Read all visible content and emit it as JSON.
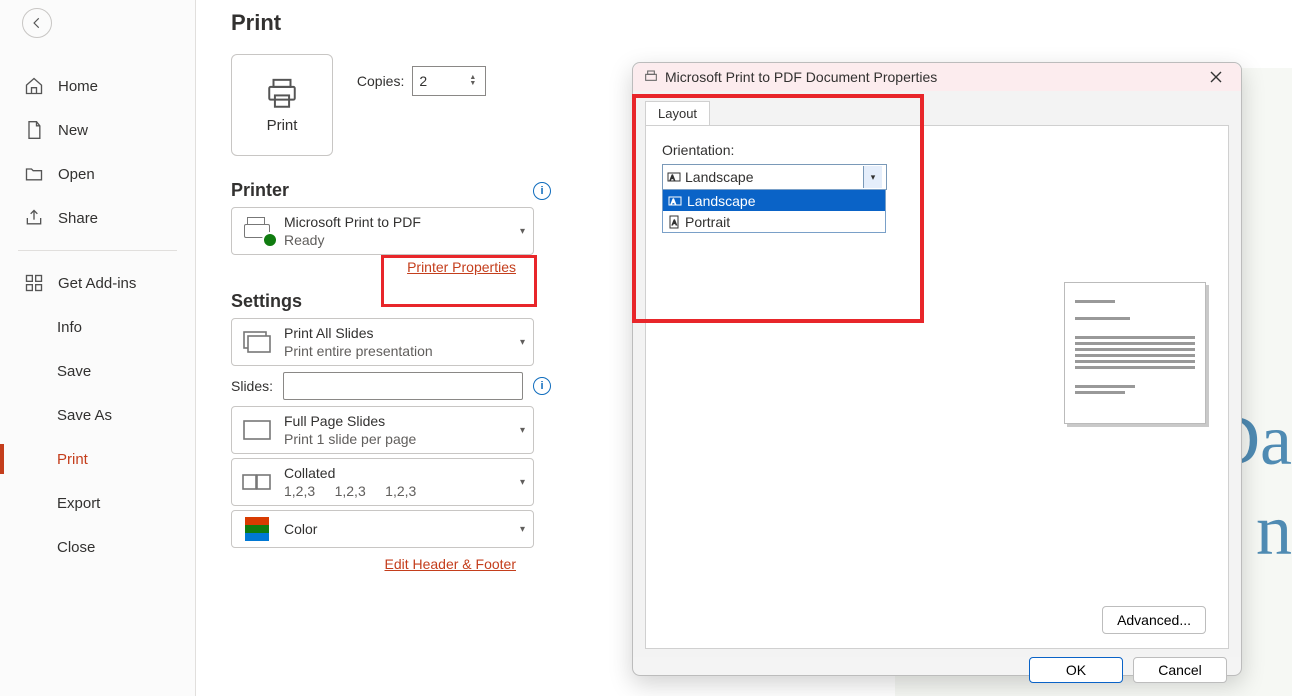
{
  "nav": {
    "home": "Home",
    "new": "New",
    "open": "Open",
    "share": "Share",
    "addins": "Get Add-ins",
    "info": "Info",
    "save": "Save",
    "saveas": "Save As",
    "print": "Print",
    "export": "Export",
    "close": "Close"
  },
  "page_title": "Print",
  "print_button": "Print",
  "copies_label": "Copies:",
  "copies_value": "2",
  "printer_heading": "Printer",
  "printer_name": "Microsoft Print to PDF",
  "printer_status": "Ready",
  "printer_properties_link": "Printer Properties",
  "settings_heading": "Settings",
  "print_all_title": "Print All Slides",
  "print_all_sub": "Print entire presentation",
  "slides_label": "Slides:",
  "full_page_title": "Full Page Slides",
  "full_page_sub": "Print 1 slide per page",
  "collated_title": "Collated",
  "collated_sub": "1,2,3     1,2,3     1,2,3",
  "color_label": "Color",
  "edit_hf_link": "Edit Header & Footer",
  "dialog": {
    "title": "Microsoft Print to PDF Document Properties",
    "tab": "Layout",
    "orientation_label": "Orientation:",
    "selected": "Landscape",
    "options": [
      "Landscape",
      "Portrait"
    ],
    "advanced": "Advanced...",
    "ok": "OK",
    "cancel": "Cancel"
  },
  "preview_partial": "Da\nn"
}
